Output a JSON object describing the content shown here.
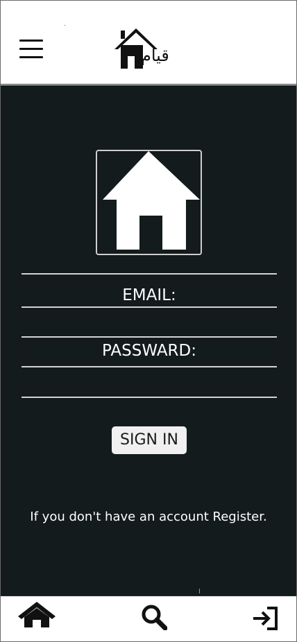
{
  "header": {
    "menu_icon": "hamburger-menu-icon",
    "logo_icon": "house-logo-icon",
    "logo_text": "قيام"
  },
  "main": {
    "hero_icon": "house-icon",
    "email_label": "EMAIL:",
    "email_value": "",
    "password_label": "PASSWARD:",
    "password_value": "",
    "signin_label": "SIGN IN",
    "register_text": "If you don't have an account Register."
  },
  "bottom_nav": {
    "items": [
      {
        "icon": "home-icon"
      },
      {
        "icon": "search-icon"
      },
      {
        "icon": "sign-in-icon"
      }
    ]
  },
  "colors": {
    "background_dark": "#131b1c",
    "header_bg": "#ffffff",
    "text_light": "#ffffff",
    "button_bg": "#f0f0f0",
    "divider": "#d4d4d4"
  }
}
